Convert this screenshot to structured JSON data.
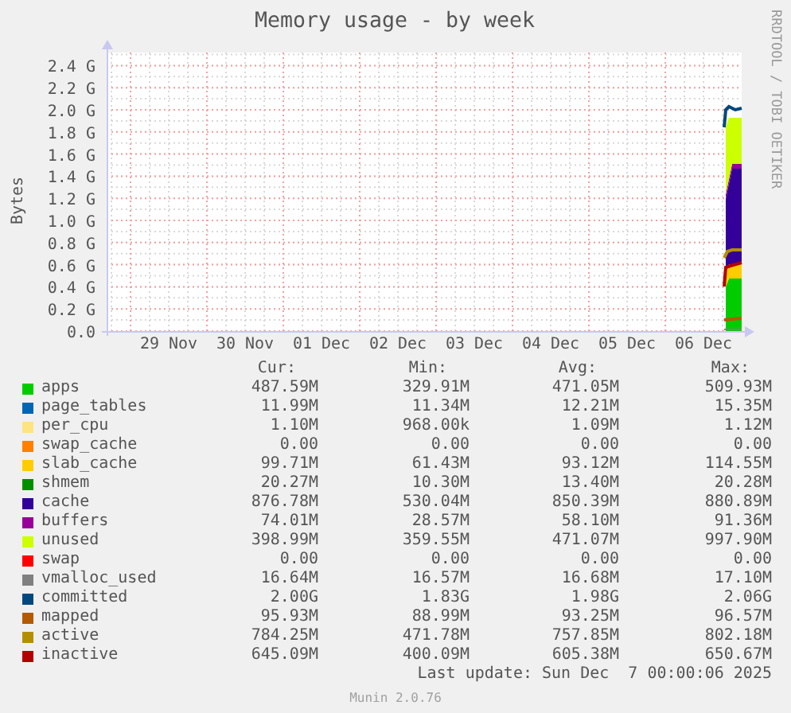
{
  "graph": {
    "title": "Memory usage - by week",
    "watermark": "RRDTOOL / TOBI OETIKER",
    "ylabel": "Bytes",
    "y_ticks": [
      "2.4 G",
      "2.2 G",
      "2.0 G",
      "1.8 G",
      "1.6 G",
      "1.4 G",
      "1.2 G",
      "1.0 G",
      "0.8 G",
      "0.6 G",
      "0.4 G",
      "0.2 G",
      "0.0"
    ],
    "x_ticks": [
      "29 Nov",
      "30 Nov",
      "01 Dec",
      "02 Dec",
      "03 Dec",
      "04 Dec",
      "05 Dec",
      "06 Dec"
    ]
  },
  "legend": {
    "columns": [
      "Cur:",
      "Min:",
      "Avg:",
      "Max:"
    ],
    "rows": [
      {
        "name": "apps",
        "color": "#00cc00",
        "cur": "487.59M",
        "min": "329.91M",
        "avg": "471.05M",
        "max": "509.93M"
      },
      {
        "name": "page_tables",
        "color": "#0066b3",
        "cur": "11.99M",
        "min": "11.34M",
        "avg": "12.21M",
        "max": "15.35M"
      },
      {
        "name": "per_cpu",
        "color": "#ffe380",
        "cur": "1.10M",
        "min": "968.00k",
        "avg": "1.09M",
        "max": "1.12M"
      },
      {
        "name": "swap_cache",
        "color": "#ff8000",
        "cur": "0.00",
        "min": "0.00",
        "avg": "0.00",
        "max": "0.00"
      },
      {
        "name": "slab_cache",
        "color": "#ffcc00",
        "cur": "99.71M",
        "min": "61.43M",
        "avg": "93.12M",
        "max": "114.55M"
      },
      {
        "name": "shmem",
        "color": "#008f00",
        "cur": "20.27M",
        "min": "10.30M",
        "avg": "13.40M",
        "max": "20.28M"
      },
      {
        "name": "cache",
        "color": "#330099",
        "cur": "876.78M",
        "min": "530.04M",
        "avg": "850.39M",
        "max": "880.89M"
      },
      {
        "name": "buffers",
        "color": "#990099",
        "cur": "74.01M",
        "min": "28.57M",
        "avg": "58.10M",
        "max": "91.36M"
      },
      {
        "name": "unused",
        "color": "#ccff00",
        "cur": "398.99M",
        "min": "359.55M",
        "avg": "471.07M",
        "max": "997.90M"
      },
      {
        "name": "swap",
        "color": "#ff0000",
        "cur": "0.00",
        "min": "0.00",
        "avg": "0.00",
        "max": "0.00"
      },
      {
        "name": "vmalloc_used",
        "color": "#808080",
        "cur": "16.64M",
        "min": "16.57M",
        "avg": "16.68M",
        "max": "17.10M"
      },
      {
        "name": "committed",
        "color": "#00487d",
        "cur": "2.00G",
        "min": "1.83G",
        "avg": "1.98G",
        "max": "2.06G"
      },
      {
        "name": "mapped",
        "color": "#b35a00",
        "cur": "95.93M",
        "min": "88.99M",
        "avg": "93.25M",
        "max": "96.57M"
      },
      {
        "name": "active",
        "color": "#b38f00",
        "cur": "784.25M",
        "min": "471.78M",
        "avg": "757.85M",
        "max": "802.18M"
      },
      {
        "name": "inactive",
        "color": "#b30000",
        "cur": "645.09M",
        "min": "400.09M",
        "avg": "605.38M",
        "max": "650.67M"
      }
    ]
  },
  "last_update": "Last update: Sun Dec  7 00:00:06 2025",
  "footer": "Munin 2.0.76"
}
